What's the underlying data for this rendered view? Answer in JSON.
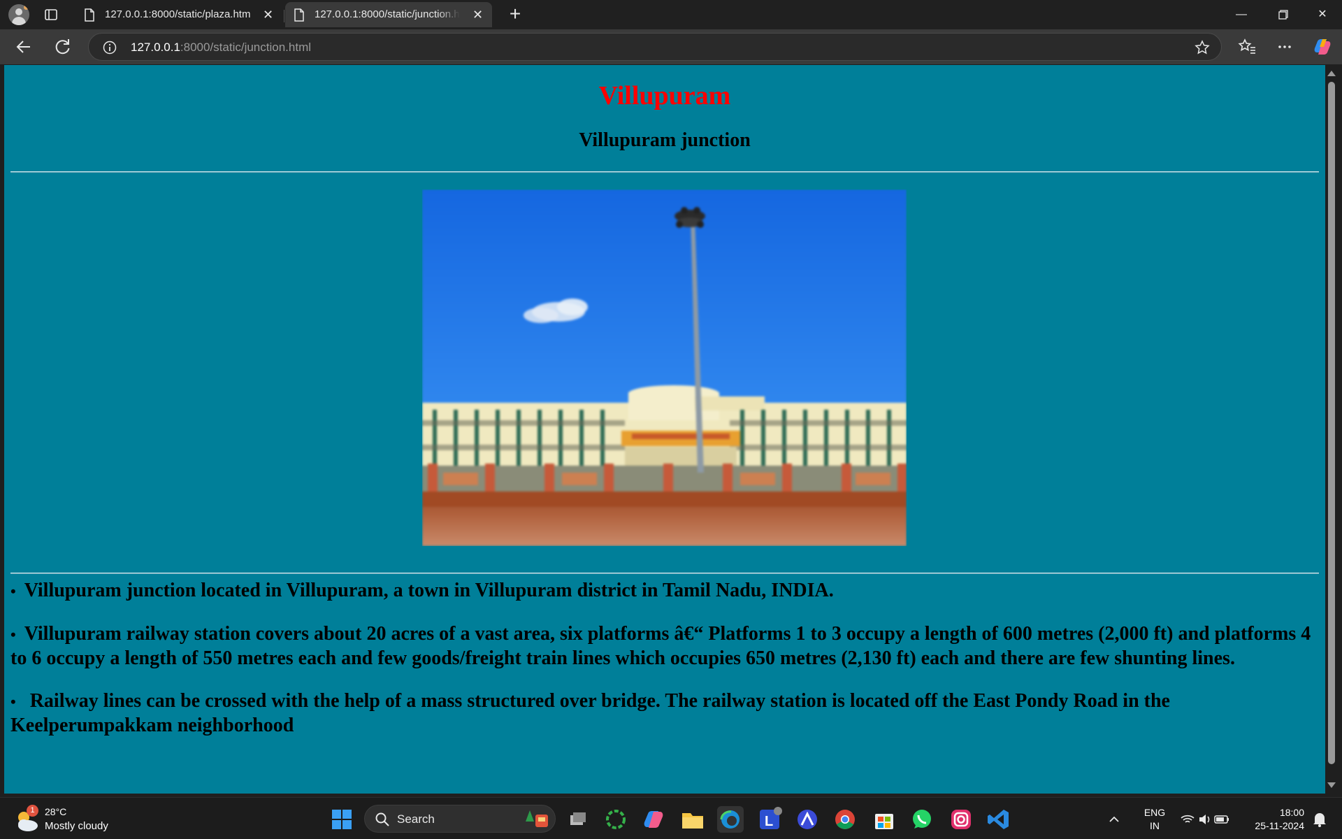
{
  "browser": {
    "tabs": [
      {
        "title": "127.0.0.1:8000/static/plaza.html",
        "active": false
      },
      {
        "title": "127.0.0.1:8000/static/junction.html",
        "active": true
      }
    ],
    "address": {
      "host": "127.0.0.1",
      "rest": ":8000/static/junction.html"
    }
  },
  "page": {
    "heading": "Villupuram",
    "subheading": "Villupuram junction",
    "bullet_glyph": "•",
    "bullets": [
      "Villupuram junction located in Villupuram, a town in Villupuram district in Tamil Nadu, INDIA.",
      "Villupuram railway station covers about 20 acres of a vast area, six platforms â€“ Platforms 1 to 3 occupy a length of 600 metres (2,000 ft) and platforms 4 to 6 occupy a length of 550 metres each and few goods/freight train lines which occupies 650 metres (2,130 ft) each and there are few shunting lines.",
      "Railway lines can be crossed with the help of a mass structured over bridge. The railway station is located off the East Pondy Road in the Keelperumpakkam neighborhood"
    ],
    "background_color": "#007f99",
    "heading_color": "#ff0000"
  },
  "taskbar": {
    "weather": {
      "temp": "28°C",
      "condition": "Mostly cloudy",
      "badge": "1"
    },
    "search_label": "Search",
    "lang": {
      "line1": "ENG",
      "line2": "IN"
    },
    "clock": {
      "time": "18:00",
      "date": "25-11-2024"
    },
    "notification_badge": "1"
  }
}
